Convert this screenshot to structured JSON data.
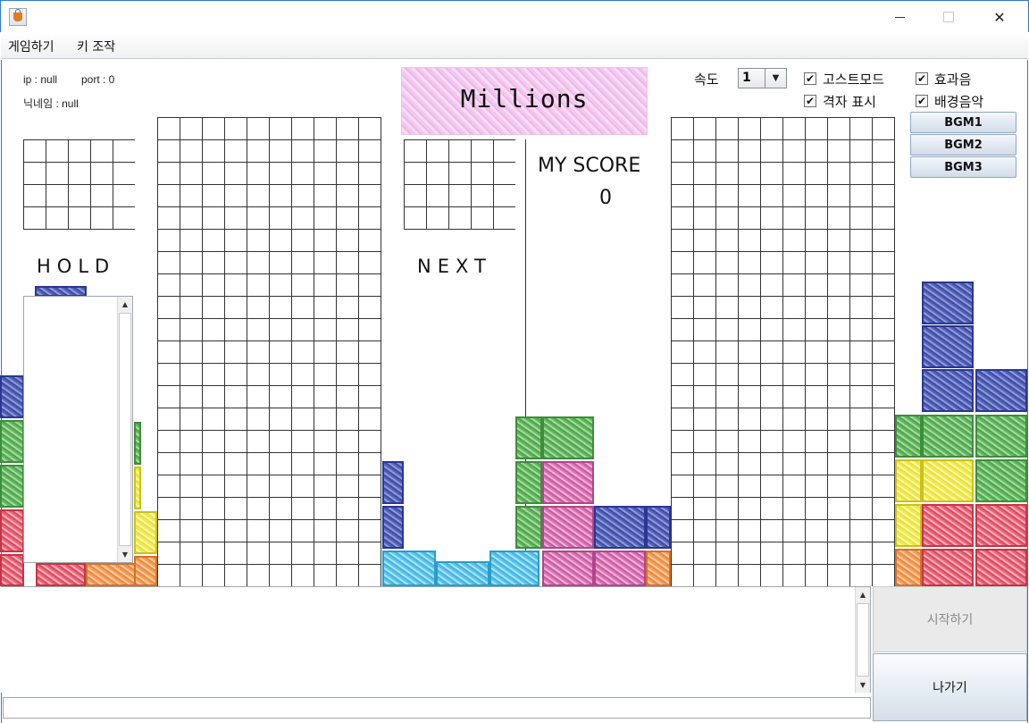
{
  "window": {
    "minimize": "",
    "maximize": "",
    "close": "✕"
  },
  "menu": [
    "게임하기",
    "키 조작"
  ],
  "info": {
    "ip": "ip : null",
    "port": "port : 0",
    "nickname": "닉네임 : null"
  },
  "logo": {
    "text": "Millions"
  },
  "labels": {
    "hold": "HOLD",
    "next": "NEXT",
    "score_title": "MY SCORE",
    "score_value": "0"
  },
  "controls": {
    "speed_label": "속도",
    "speed_value": "1",
    "ghost_mode": {
      "label": "고스트모드",
      "checked": true
    },
    "grid_show": {
      "label": "격자 표시",
      "checked": true
    },
    "sound_effect": {
      "label": "효과음",
      "checked": true
    },
    "bgm": {
      "label": "배경음악",
      "checked": true
    },
    "bgm_buttons": [
      "BGM1",
      "BGM2",
      "BGM3"
    ]
  },
  "chat": {
    "input_value": ""
  },
  "buttons": {
    "start": "시작하기",
    "exit": "나가기"
  }
}
